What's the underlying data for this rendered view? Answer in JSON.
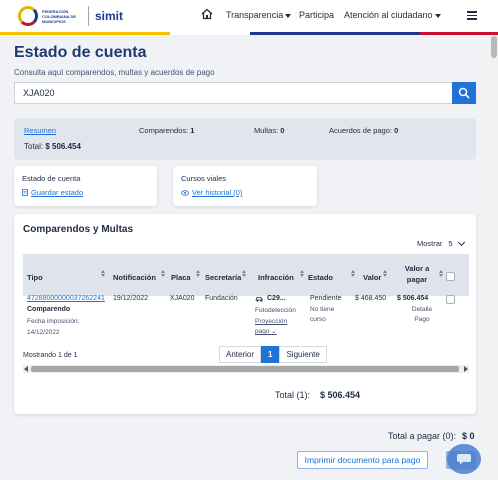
{
  "header": {
    "logo_text": "FEDERACIÓN COLOMBIANA DE MUNICIPIOS",
    "brand": "simit",
    "nav": [
      {
        "label": "Transparencia"
      },
      {
        "label": "Participa"
      },
      {
        "label": "Atención al ciudadano"
      }
    ],
    "stripe_colors": [
      "#f3c300",
      "#1b3a8c",
      "#c8102e"
    ]
  },
  "page": {
    "title": "Estado de cuenta",
    "subtitle": "Consulta aquí comparendos, multas y acuerdos de pago"
  },
  "search": {
    "value": "XJA020"
  },
  "summary": {
    "resumen_label": "Resumen",
    "comparendos_label": "Comparendos:",
    "comparendos_value": "1",
    "multas_label": "Multas:",
    "multas_value": "0",
    "acuerdos_label": "Acuerdos de pago:",
    "acuerdos_value": "0",
    "total_label": "Total:",
    "total_value": "$ 506.454"
  },
  "cards": {
    "estado": {
      "title": "Estado de cuenta",
      "link": "Guardar estado"
    },
    "cursos": {
      "title": "Cursos viales",
      "link": "Ver historial (0)"
    }
  },
  "table": {
    "title": "Comparendos y Multas",
    "mostrar_label": "Mostrar",
    "mostrar_value": "5",
    "columns": [
      "Tipo",
      "Notificación",
      "Placa",
      "Secretaría",
      "Infracción",
      "Estado",
      "Valor",
      "Valor a pagar"
    ],
    "row": {
      "numero": "47288000000037262241",
      "tipo": "Comparendo",
      "fecha_label": "Fecha imposición:",
      "fecha": "14/12/2022",
      "notificacion": "19/12/2022",
      "placa": "XJA020",
      "secretaria": "Fundación",
      "infraccion_code": "C29...",
      "infraccion_detail": "Fotodetección",
      "proyeccion_link": "Proyección pago",
      "estado": "Pendiente",
      "estado_detail": "No tiene curso",
      "valor": "$ 468.450",
      "valor_pagar": "$ 506.454",
      "detalle_label": "Detalle Pago"
    },
    "mostrando": "Mostrando 1 de 1",
    "pager": {
      "prev": "Anterior",
      "page": "1",
      "next": "Siguiente"
    },
    "total_label": "Total (1):",
    "total_value": "$ 506.454"
  },
  "footer": {
    "total_pagar_label": "Total a pagar (0):",
    "total_pagar_value": "$ 0",
    "print_label": "Imprimir documento para pago"
  },
  "colors": {
    "primary": "#1f72d6",
    "title": "#1f3b6e",
    "summary_bg": "#e1e5ee"
  }
}
